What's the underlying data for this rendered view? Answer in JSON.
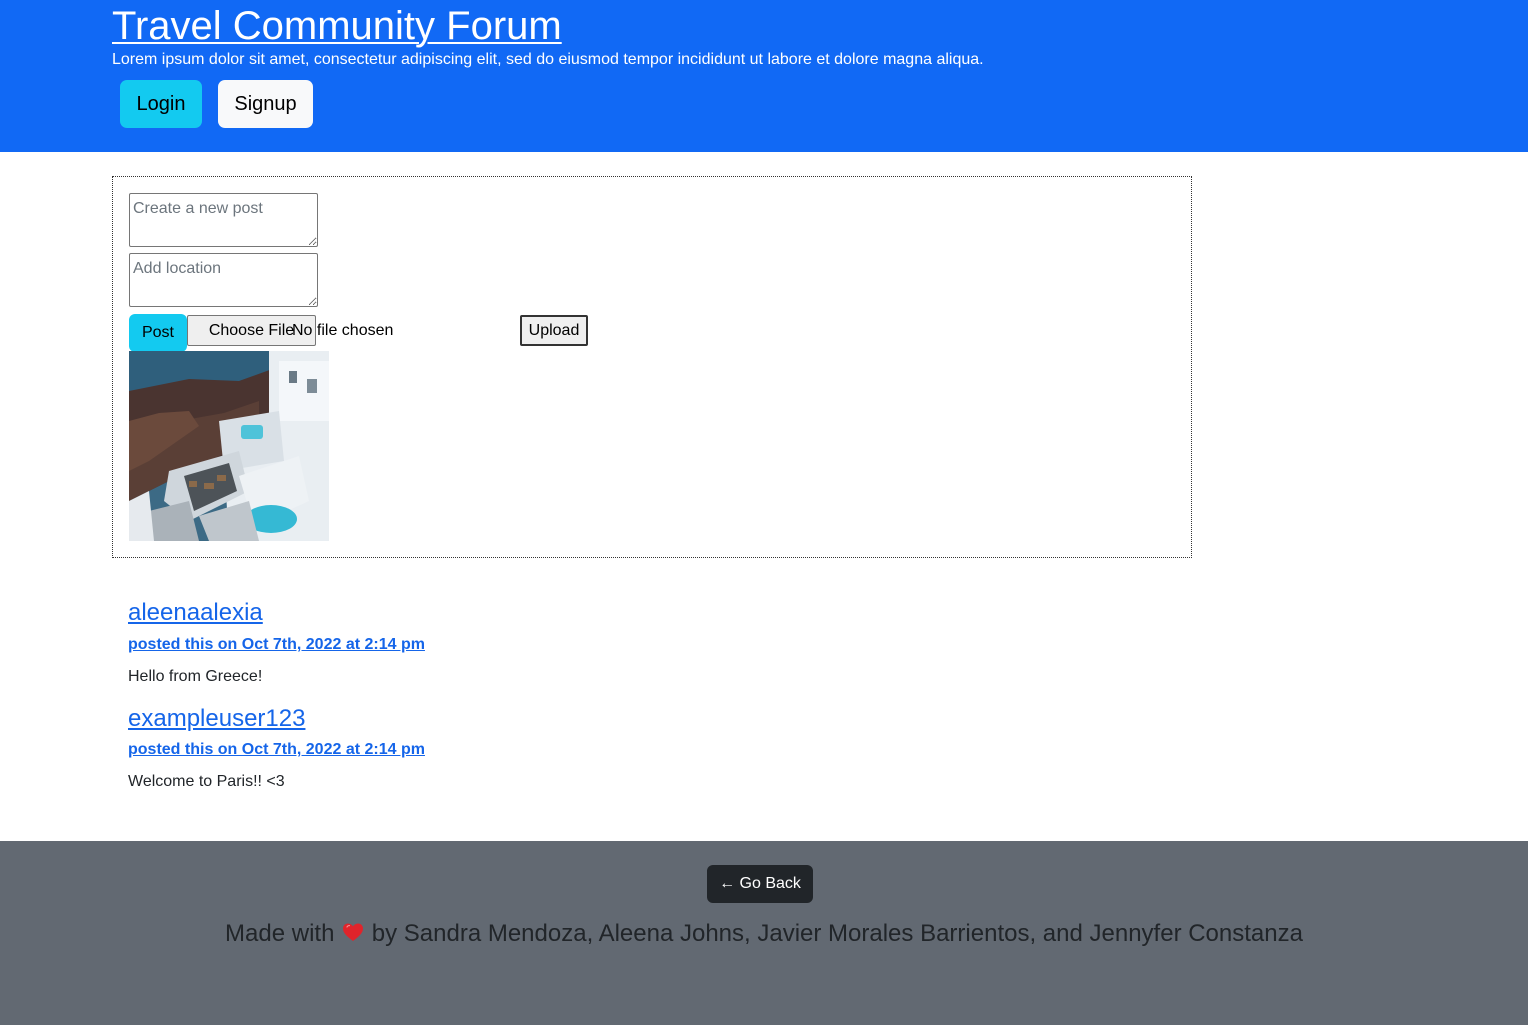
{
  "header": {
    "title": "Travel Community Forum",
    "tagline": "Lorem ipsum dolor sit amet, consectetur adipiscing elit, sed do eiusmod tempor incididunt ut labore et dolore magna aliqua.",
    "login_label": "Login",
    "signup_label": "Signup"
  },
  "post_form": {
    "post_placeholder": "Create a new post",
    "post_value": "",
    "location_placeholder": "Add location",
    "location_value": "",
    "post_button": "Post",
    "choose_file_button": "Choose File",
    "file_status": "No file chosen",
    "upload_button": "Upload"
  },
  "posts": [
    {
      "username": "aleenaalexia",
      "meta": "posted this on Oct 7th, 2022 at 2:14 pm",
      "text": "Hello from Greece!"
    },
    {
      "username": "exampleuser123",
      "meta": "posted this on Oct 7th, 2022 at 2:14 pm",
      "text": "Welcome to Paris!! <3"
    }
  ],
  "footer": {
    "go_back_label": "← Go Back",
    "made_with": "Made with",
    "heart_icon": "heart-icon",
    "credits": "by Sandra Mendoza, Aleena Johns, Javier Morales Barrientos, and Jennyfer Constanza"
  },
  "colors": {
    "header_bg": "#1169f5",
    "info_button": "#13caf0",
    "light_button": "#f8f9fa",
    "link": "#1565e9",
    "footer_bg": "#626972",
    "dark_button": "#212529",
    "heart": "#e0242b"
  }
}
